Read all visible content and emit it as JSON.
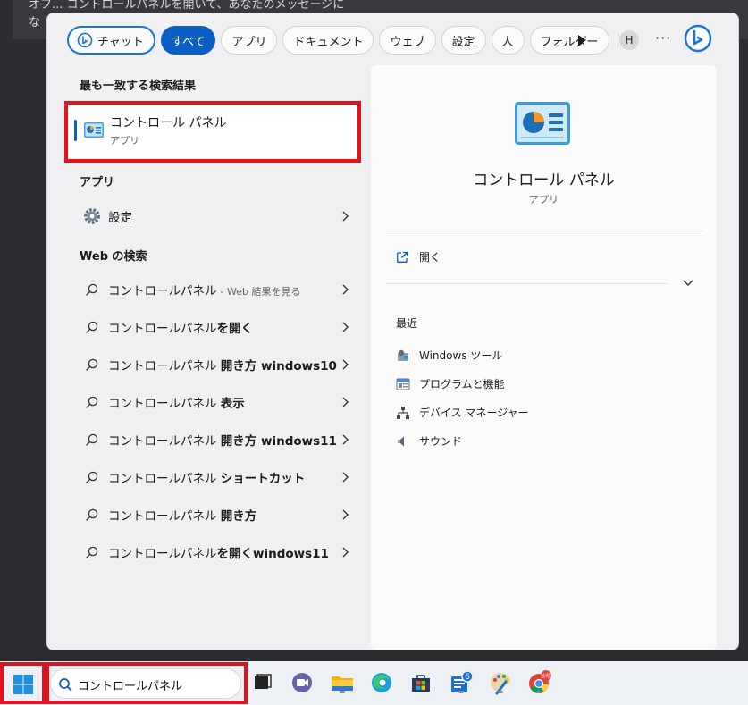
{
  "background": {
    "line1": "オフ... コントロールパネルを開いて、あなたのメッセージに",
    "line2": "な"
  },
  "chips": {
    "items": [
      {
        "label": "チャット"
      },
      {
        "label": "すべて"
      },
      {
        "label": "アプリ"
      },
      {
        "label": "ドキュメント"
      },
      {
        "label": "ウェブ"
      },
      {
        "label": "設定"
      },
      {
        "label": "人"
      },
      {
        "label": "フォルダー"
      }
    ],
    "avatar_initial": "H",
    "more_label": "···"
  },
  "left": {
    "best_match_title": "最も一致する検索結果",
    "best_match": {
      "name": "コントロール パネル",
      "type": "アプリ"
    },
    "apps_title": "アプリ",
    "apps": [
      {
        "label": "設定"
      }
    ],
    "web_title": "Web の検索",
    "web_results": [
      {
        "query": "コントロールパネル",
        "bold": "",
        "note": "- Web 結果を見る"
      },
      {
        "query": "コントロールパネル",
        "bold": "を開く",
        "note": ""
      },
      {
        "query": "コントロールパネル ",
        "bold": "開き方 windows10",
        "note": ""
      },
      {
        "query": "コントロールパネル ",
        "bold": "表示",
        "note": ""
      },
      {
        "query": "コントロールパネル ",
        "bold": "開き方 windows11",
        "note": ""
      },
      {
        "query": "コントロールパネル ",
        "bold": "ショートカット",
        "note": ""
      },
      {
        "query": "コントロールパネル ",
        "bold": "開き方",
        "note": ""
      },
      {
        "query": "コントロールパネル",
        "bold": "を開くwindows11",
        "note": ""
      }
    ]
  },
  "right": {
    "title": "コントロール パネル",
    "subtitle": "アプリ",
    "open_label": "開く",
    "recent_label": "最近",
    "recent": [
      {
        "label": "Windows ツール",
        "icon": "windows-tools-icon"
      },
      {
        "label": "プログラムと機能",
        "icon": "programs-features-icon"
      },
      {
        "label": "デバイス マネージャー",
        "icon": "device-manager-icon"
      },
      {
        "label": "サウンド",
        "icon": "sound-icon"
      }
    ]
  },
  "taskbar": {
    "search_value": "コントロールパネル",
    "badge_count": "6",
    "chrome_badge": "沙哈"
  },
  "colors": {
    "accent": "#0a5fc4",
    "highlight": "#e0141e"
  }
}
